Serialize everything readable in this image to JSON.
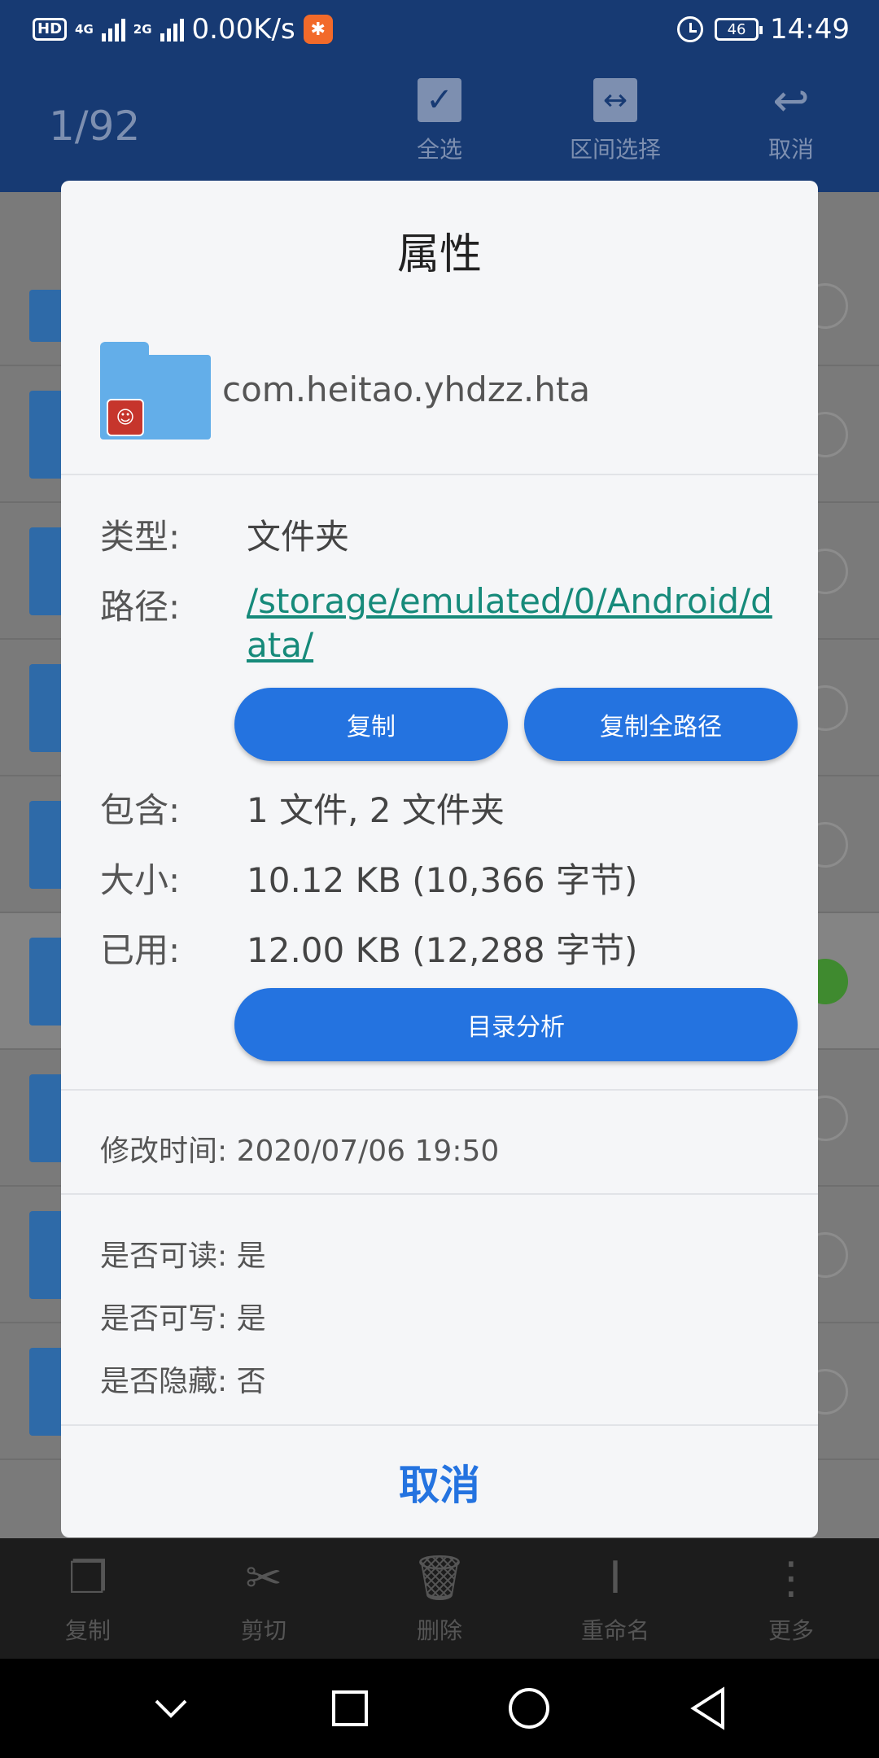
{
  "status_bar": {
    "hd": "HD",
    "net1": "4G",
    "net2": "2G",
    "speed": "0.00K/s",
    "battery": "46",
    "time": "14:49"
  },
  "toolbar": {
    "selection_count": "1/92",
    "select_all": "全选",
    "range_select": "区间选择",
    "cancel": "取消"
  },
  "bottom_bar": {
    "copy": "复制",
    "cut": "剪切",
    "delete": "删除",
    "rename": "重命名",
    "more": "更多"
  },
  "dialog": {
    "title": "属性",
    "file_name": "com.heitao.yhdzz.hta",
    "type_label": "类型:",
    "type_value": "文件夹",
    "path_label": "路径:",
    "path_value": "/storage/emulated/0/Android/data/",
    "copy_button": "复制",
    "copy_full_path_button": "复制全路径",
    "contains_label": "包含:",
    "contains_value": "1 文件, 2 文件夹",
    "size_label": "大小:",
    "size_value": "10.12 KB (10,366 字节)",
    "used_label": "已用:",
    "used_value": "12.00 KB (12,288 字节)",
    "dir_analysis_button": "目录分析",
    "modified": "修改时间: 2020/07/06 19:50",
    "readable": "是否可读: 是",
    "writable": "是否可写: 是",
    "hidden": "是否隐藏: 否",
    "cancel_button": "取消"
  },
  "colors": {
    "header_bg": "#173a73",
    "accent": "#2473e0",
    "link": "#168a7a",
    "folder": "#63aee9"
  }
}
